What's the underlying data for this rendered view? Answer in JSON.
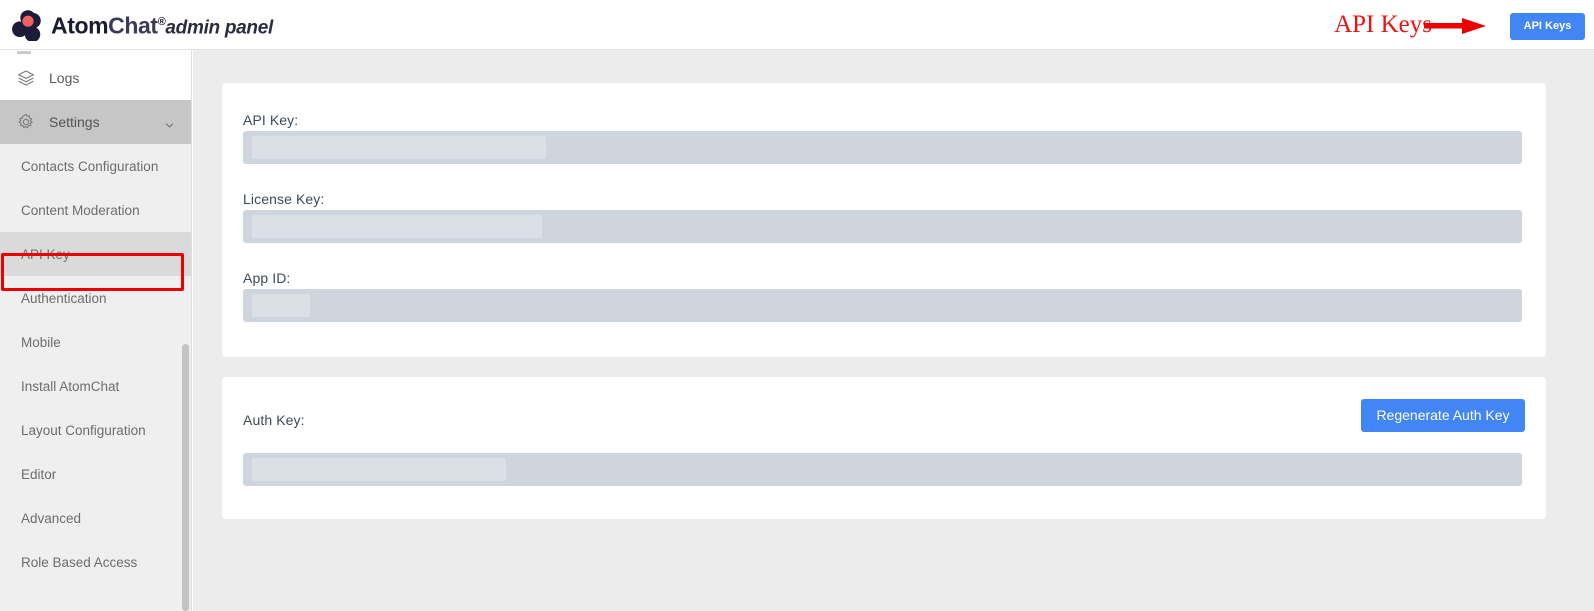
{
  "header": {
    "logo_icon": "atomchat-trefoil-logo",
    "brand_atom": "Atom",
    "brand_chat": "Chat",
    "brand_registered": "®",
    "brand_admin": "admin panel",
    "api_keys_button": "API Keys"
  },
  "annotation": {
    "label": "API Keys",
    "color": "#ee1111",
    "arrow_icon": "right-arrow-annotation"
  },
  "sidebar": {
    "nav": [
      {
        "label": "Logs",
        "icon": "layers-icon",
        "state": "default"
      },
      {
        "label": "Settings",
        "icon": "gear-icon",
        "state": "expanded",
        "chevron": "chevron-down-icon"
      }
    ],
    "sub_items": [
      {
        "label": "Contacts Configuration",
        "state": "default"
      },
      {
        "label": "Content Moderation",
        "state": "default"
      },
      {
        "label": "API Key",
        "state": "active"
      },
      {
        "label": "Authentication",
        "state": "default"
      },
      {
        "label": "Mobile",
        "state": "default"
      },
      {
        "label": "Install AtomChat",
        "state": "default"
      },
      {
        "label": "Layout Configuration",
        "state": "default"
      },
      {
        "label": "Editor",
        "state": "default"
      },
      {
        "label": "Advanced",
        "state": "default"
      },
      {
        "label": "Role Based Access",
        "state": "default"
      }
    ],
    "scrollbar": "vertical-scrollbar"
  },
  "main": {
    "keys_card": {
      "fields": [
        {
          "label": "API Key:",
          "value": "",
          "redacted": true,
          "redact_width": 294
        },
        {
          "label": "License Key:",
          "value": "",
          "redacted": true,
          "redact_width": 290
        },
        {
          "label": "App ID:",
          "value": "",
          "redacted": true,
          "redact_width": 58
        }
      ]
    },
    "auth_card": {
      "label": "Auth Key:",
      "value": "",
      "redacted": true,
      "redact_width": 254,
      "regenerate_button": "Regenerate Auth Key"
    }
  },
  "colors": {
    "accent_blue": "#4285f4",
    "annotation_red": "#ee0000",
    "sidebar_bg": "#efefef",
    "sidebar_active": "#dadada",
    "sidebar_parent_active": "#c6c6c6",
    "main_bg": "#ececec",
    "field_bg": "#ced5dc",
    "redact_bg": "#dae0e5"
  }
}
